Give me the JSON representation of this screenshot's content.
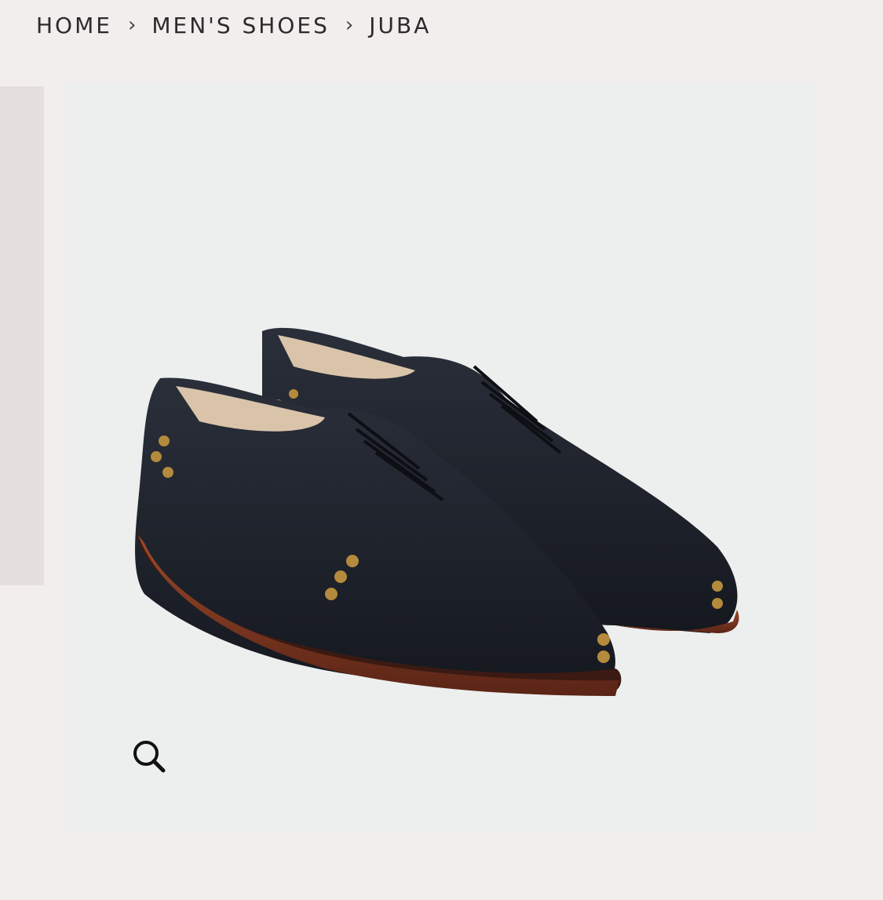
{
  "breadcrumb": {
    "items": [
      {
        "label": "HOME"
      },
      {
        "label": "MEN'S SHOES"
      },
      {
        "label": "JUBA"
      }
    ],
    "separator": "›"
  },
  "product_image": {
    "alt": "JUBA",
    "icon": "shoe-pair"
  },
  "zoom": {
    "icon": "magnifier-icon"
  },
  "colors": {
    "page_bg": "#f3eeee",
    "image_bg": "#edefee",
    "thumb_strip": "#e6dfdf",
    "leather": "#1e222b",
    "sole": "#8a3a22",
    "studs": "#b48a3c"
  }
}
